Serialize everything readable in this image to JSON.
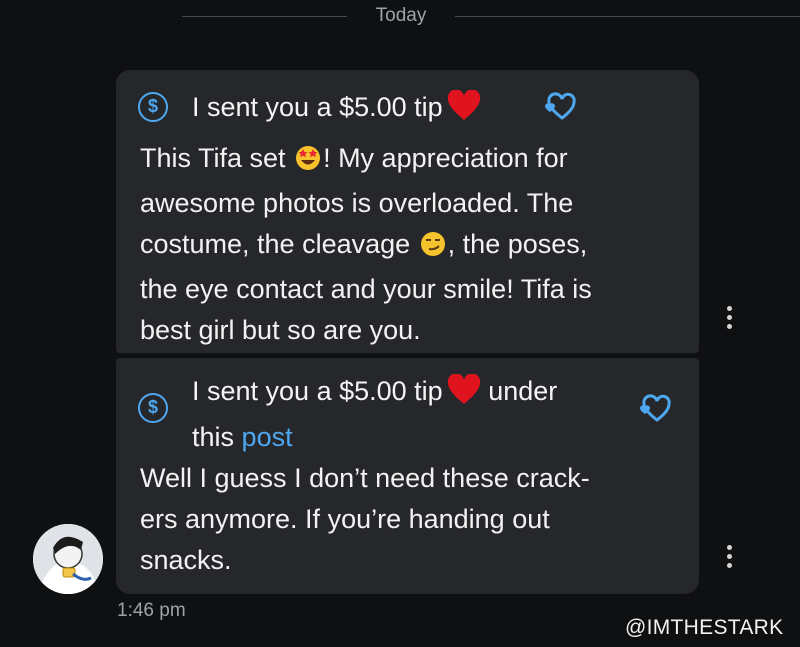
{
  "date_separator": "Today",
  "messages": [
    {
      "tip_icon_symbol": "$",
      "heading": "I sent you a $5.00 tip",
      "heading_icon": "red-heart-emoji",
      "action_icon": "heart-outline-icon",
      "body": {
        "l1a": "This Tifa set ",
        "l1_emoji": "star-struck-emoji",
        "l1b": "! My appreciation for",
        "l2": "awesome photos is overloaded. The",
        "l3a": "costume, the cleavage ",
        "l3_emoji": "smirking-face-emoji",
        "l3b": ", the poses,",
        "l4": "the eye contact and your smile! Tifa is",
        "l5": "best girl but so are you."
      },
      "menu_icon": "more-vertical-icon"
    },
    {
      "tip_icon_symbol": "$",
      "heading": "I sent you a $5.00 tip",
      "heading_icon": "red-heart-emoji",
      "heading_after": "under",
      "heading_line2_prefix": "this",
      "heading_link": "post",
      "action_icon": "heart-outline-icon",
      "body": {
        "l1": "Well I guess I don’t need these crack-",
        "l2": "ers anymore. If you’re handing out",
        "l3": "snacks."
      },
      "menu_icon": "more-vertical-icon"
    }
  ],
  "timestamp": "1:46 pm",
  "watermark": "@IMTHESTARK",
  "colors": {
    "background": "#0f1012",
    "bubble": "#26272b",
    "accent": "#4ea8ef",
    "heart": "#e0141f",
    "muted_text": "#9fa2a6"
  }
}
